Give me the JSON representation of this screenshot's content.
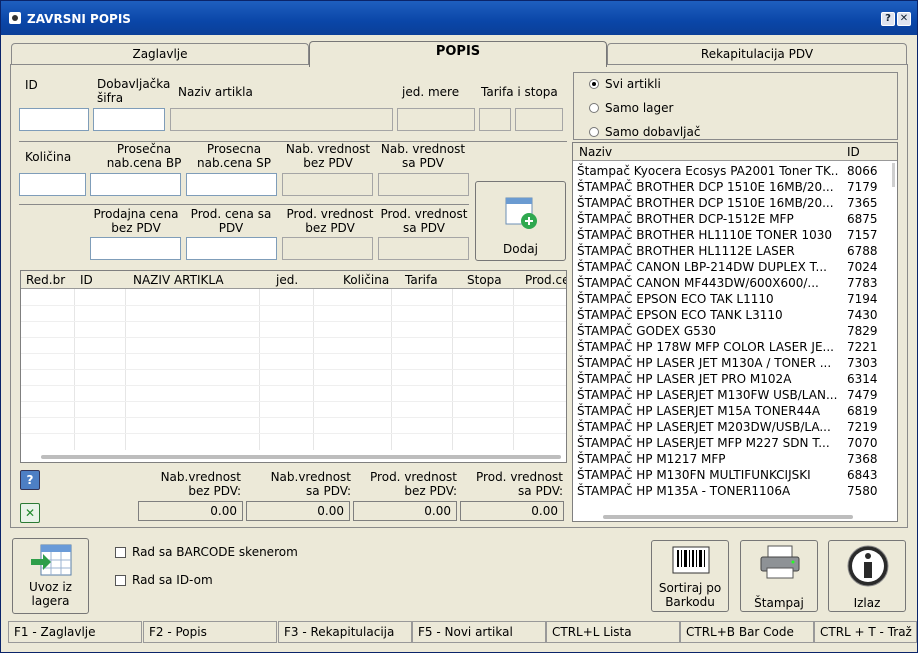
{
  "window": {
    "title": "ZAVRSNI POPIS",
    "help_glyph": "?",
    "close_glyph": "✕"
  },
  "tabs": [
    "Zaglavlje",
    "POPIS",
    "Rekapitulacija PDV"
  ],
  "labels": {
    "id": "ID",
    "dob_sifra": "Dobavljačka šifra",
    "naziv": "Naziv artikla",
    "jed_mere": "jed. mere",
    "tarifa": "Tarifa i stopa",
    "kolicina": "Količina",
    "pros_bp": "Prosečna nab.cena BP",
    "pros_sp": "Prosecna nab.cena SP",
    "nab_bez": "Nab. vrednost bez PDV",
    "nab_sa": "Nab. vrednost sa PDV",
    "prod_bez": "Prodajna cena bez PDV",
    "prod_sa": "Prod. cena sa PDV",
    "prodv_bez": "Prod. vrednost bez PDV",
    "prodv_sa": "Prod. vrednost sa PDV"
  },
  "add_button": "Dodaj",
  "grid_headers": [
    "Red.br",
    "ID",
    "NAZIV ARTIKLA",
    "jed.",
    "Količina",
    "Tarifa",
    "Stopa",
    "Prod.ce"
  ],
  "totals": [
    {
      "label": "Nab.vrednost bez PDV:",
      "value": "0.00"
    },
    {
      "label": "Nab.vrednost sa PDV:",
      "value": "0.00"
    },
    {
      "label": "Prod. vrednost bez PDV:",
      "value": "0.00"
    },
    {
      "label": "Prod. vrednost sa PDV:",
      "value": "0.00"
    }
  ],
  "radios": [
    {
      "label": "Svi artikli",
      "checked": true
    },
    {
      "label": "Samo lager",
      "checked": false
    },
    {
      "label": "Samo dobavljač",
      "checked": false
    }
  ],
  "list": {
    "headers": [
      "Naziv",
      "ID"
    ],
    "rows": [
      [
        "Štampač Kyocera Ecosys PA2001 Toner TK...",
        "8066"
      ],
      [
        "ŠTAMPAČ BROTHER DCP 1510E 16MB/20...",
        "7179"
      ],
      [
        "ŠTAMPAČ BROTHER DCP 1510E 16MB/20...",
        "7365"
      ],
      [
        "ŠTAMPAČ BROTHER DCP-1512E MFP",
        "6875"
      ],
      [
        "ŠTAMPAČ BROTHER HL1110E TONER 1030",
        "7157"
      ],
      [
        "ŠTAMPAČ BROTHER HL1112E LASER",
        "6788"
      ],
      [
        "ŠTAMPAČ CANON LBP-214DW DUPLEX T...",
        "7024"
      ],
      [
        "ŠTAMPAČ CANON MF443DW/600X600/...",
        "7783"
      ],
      [
        "ŠTAMPAČ EPSON ECO TAK L1110",
        "7194"
      ],
      [
        "ŠTAMPAČ EPSON ECO TANK L3110",
        "7430"
      ],
      [
        "ŠTAMPAČ GODEX G530",
        "7829"
      ],
      [
        "ŠTAMPAČ HP 178W MFP COLOR LASER JE...",
        "7221"
      ],
      [
        "ŠTAMPAČ HP LASER JET M130A / TONER ...",
        "7303"
      ],
      [
        "ŠTAMPAČ HP LASER JET PRO M102A",
        "6314"
      ],
      [
        "ŠTAMPAČ HP LASERJET M130FW USB/LAN...",
        "7479"
      ],
      [
        "ŠTAMPAČ HP LASERJET M15A  TONER44A",
        "6819"
      ],
      [
        "ŠTAMPAČ HP LASERJET M203DW/USB/LA...",
        "7219"
      ],
      [
        "ŠTAMPAČ HP LASERJET MFP M227 SDN T...",
        "7070"
      ],
      [
        "ŠTAMPAČ HP M1217 MFP",
        "7368"
      ],
      [
        "ŠTAMPAČ HP M130FN MULTIFUNKCIJSKI",
        "6843"
      ],
      [
        "ŠTAMPAČ HP M135A - TONER1106A",
        "7580"
      ]
    ]
  },
  "bottom": {
    "uvoz": "Uvoz iz lagera",
    "barcode_chk": "Rad sa BARCODE skenerom",
    "id_chk": "Rad sa ID-om",
    "sortiraj": "Sortiraj po Barkodu",
    "stampaj": "Štampaj",
    "izlaz": "Izlaz"
  },
  "status": [
    "F1 - Zaglavlje",
    "F2 - Popis",
    "F3 - Rekapitulacija",
    "F5 - Novi artikal",
    "CTRL+L Lista",
    "CTRL+B Bar Code",
    "CTRL + T - Traž"
  ]
}
